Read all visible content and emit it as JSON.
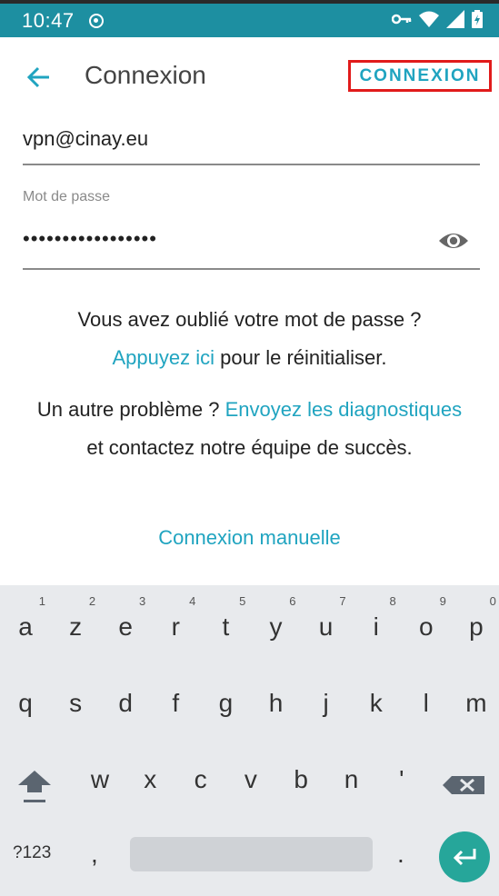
{
  "status_bar": {
    "time": "10:47",
    "icons": [
      "circle-dot-icon",
      "vpn-key-icon",
      "wifi-icon",
      "signal-icon",
      "battery-icon"
    ]
  },
  "header": {
    "title": "Connexion",
    "connect_label": "CONNEXION",
    "accent_color": "#20a4c0",
    "highlight_color": "#e11b1b"
  },
  "form": {
    "email_value": "vpn@cinay.eu",
    "password_label": "Mot de passe",
    "password_value": "•••••••••••••••••"
  },
  "help": {
    "forgot_line": "Vous avez oublié votre mot de passe ?",
    "tap_here_link": "Appuyez ici",
    "reset_text": " pour le réinitialiser.",
    "other_problem_text": "Un autre problème ? ",
    "send_diagnostics_link": "Envoyez les diagnostiques",
    "contact_text": " et contactez notre équipe de succès.",
    "manual_connection_link": "Connexion manuelle"
  },
  "keyboard": {
    "row1": [
      {
        "ch": "a",
        "hint": "1"
      },
      {
        "ch": "z",
        "hint": "2"
      },
      {
        "ch": "e",
        "hint": "3"
      },
      {
        "ch": "r",
        "hint": "4"
      },
      {
        "ch": "t",
        "hint": "5"
      },
      {
        "ch": "y",
        "hint": "6"
      },
      {
        "ch": "u",
        "hint": "7"
      },
      {
        "ch": "i",
        "hint": "8"
      },
      {
        "ch": "o",
        "hint": "9"
      },
      {
        "ch": "p",
        "hint": "0"
      }
    ],
    "row2": [
      "q",
      "s",
      "d",
      "f",
      "g",
      "h",
      "j",
      "k",
      "l",
      "m"
    ],
    "row3": [
      "w",
      "x",
      "c",
      "v",
      "b",
      "n",
      "'"
    ],
    "symbols_label": "?123",
    "comma": ",",
    "period": "."
  }
}
